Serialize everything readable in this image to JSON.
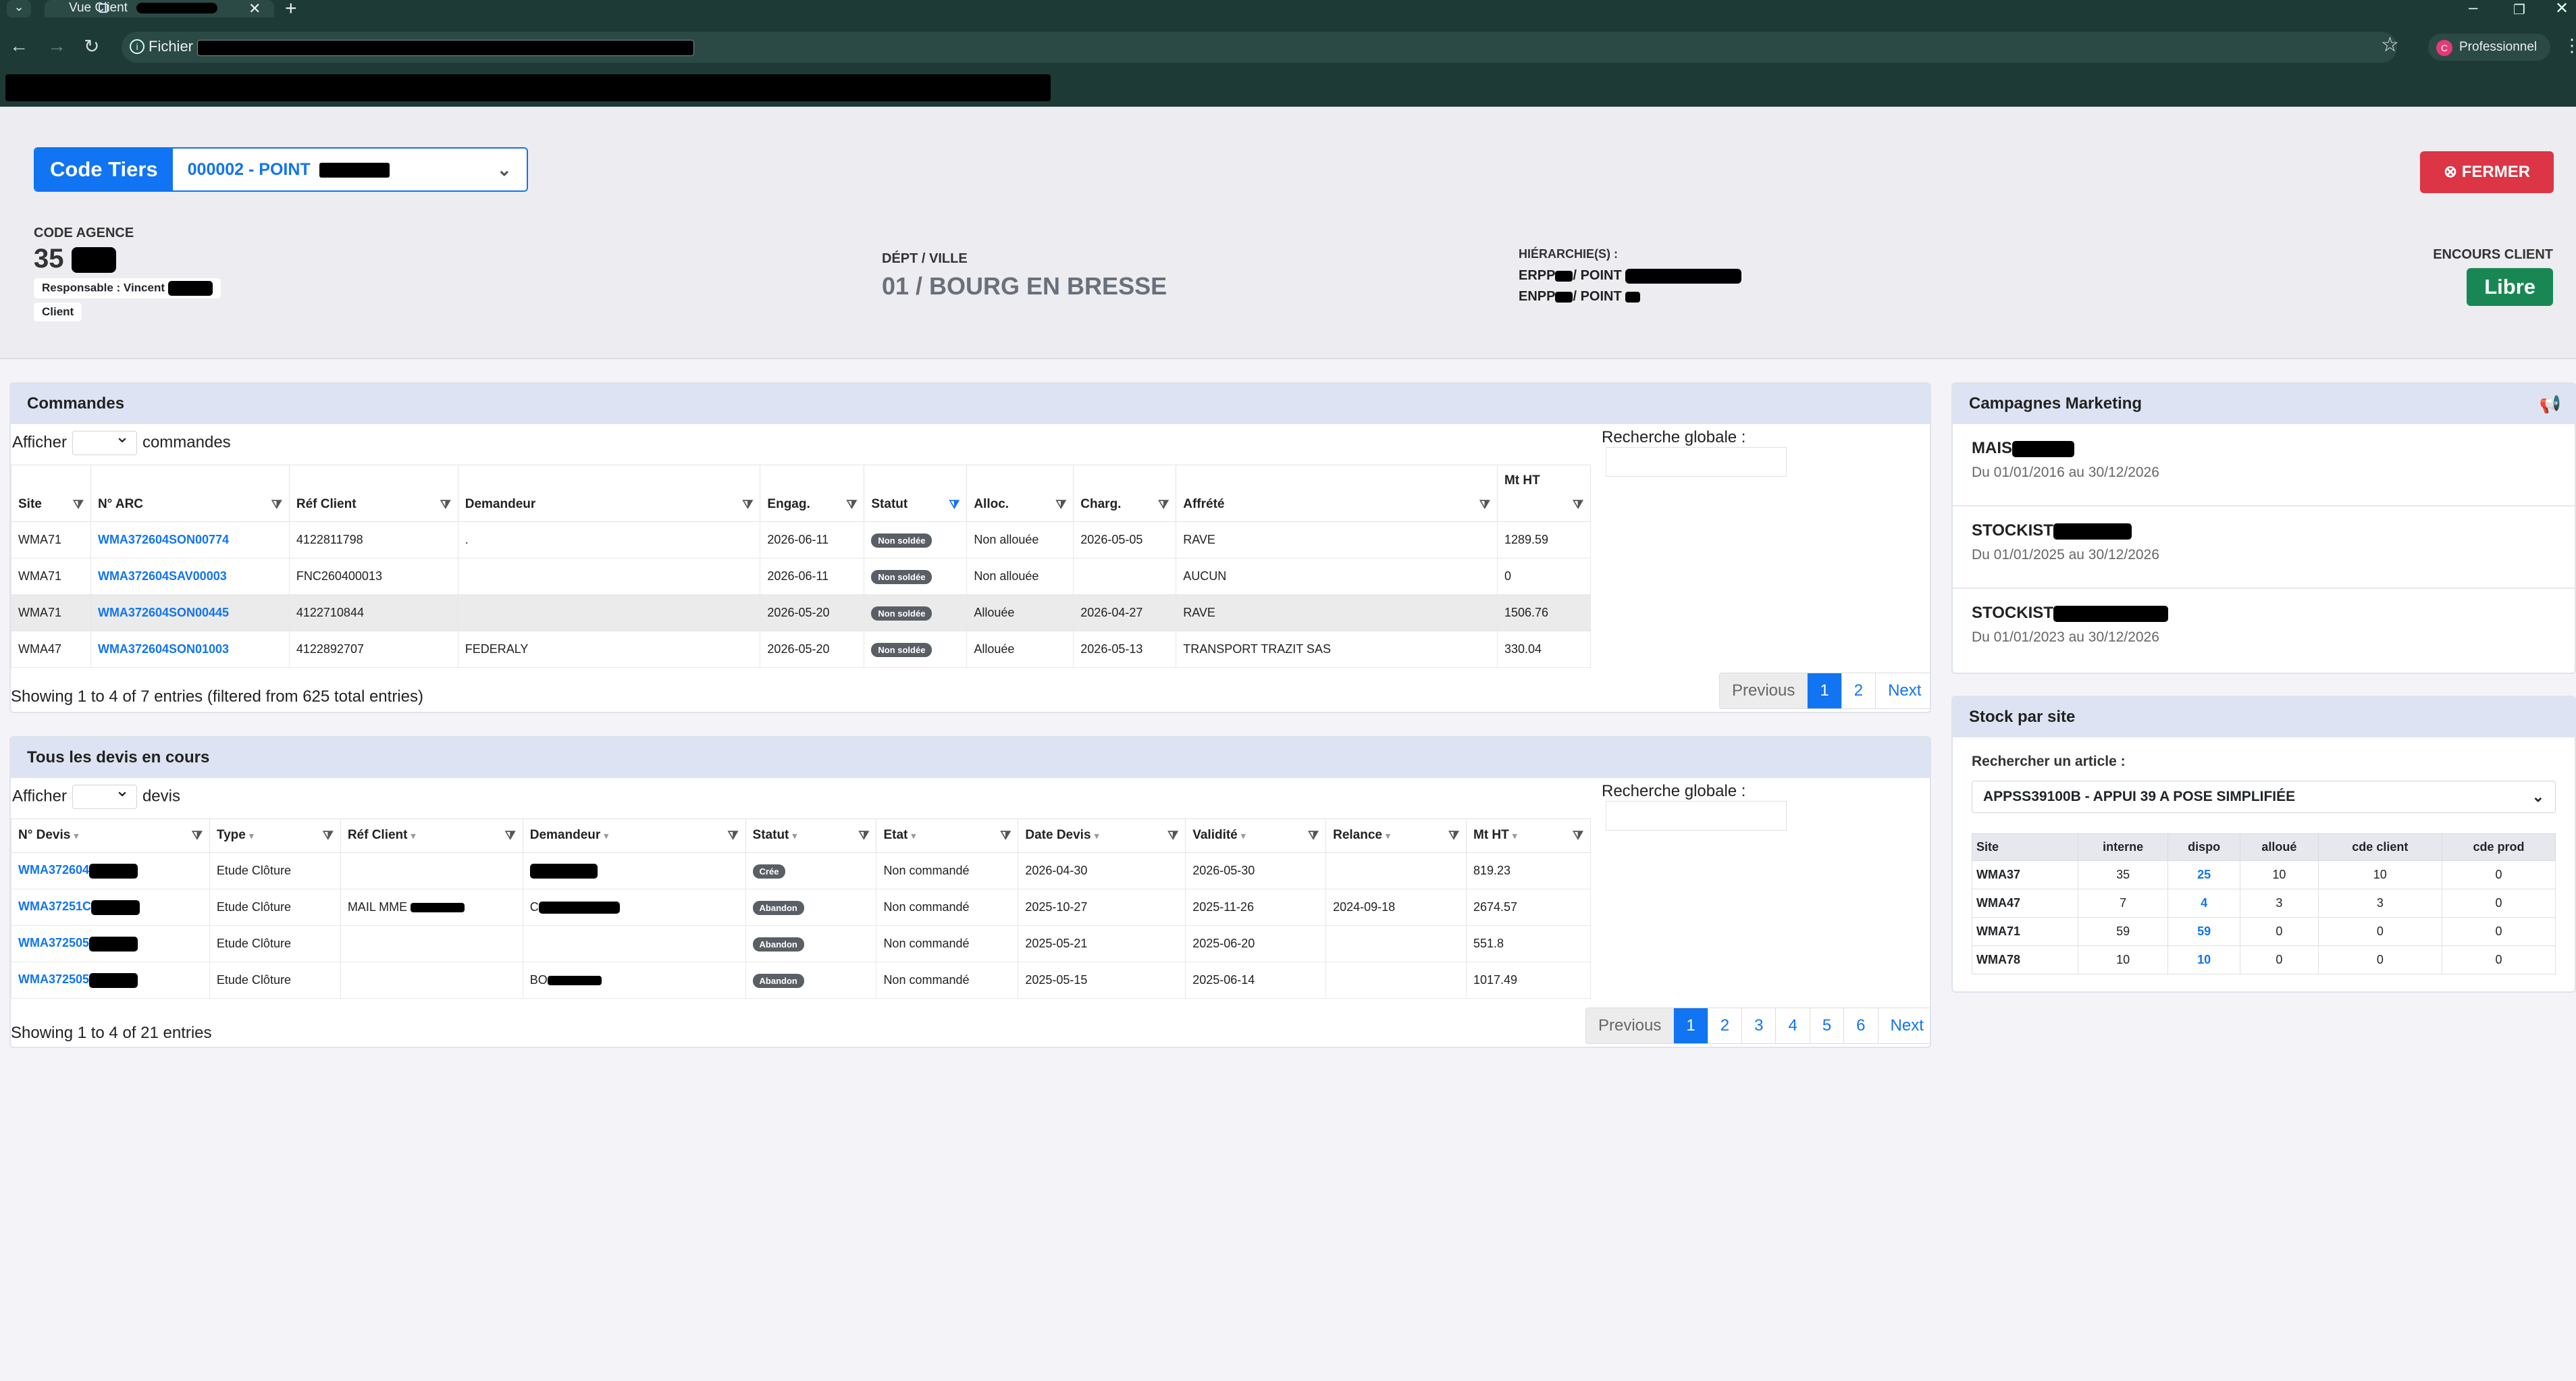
{
  "browser": {
    "tab_title": "Vue Client",
    "tab_close": "✕",
    "new_tab": "+",
    "url_scheme_label": "Fichier",
    "profile_initial": "C",
    "profile_label": "Professionnel"
  },
  "header": {
    "code_tiers_label": "Code Tiers",
    "code_tiers_value": "000002 - POINT",
    "fermer_label": "FERMER",
    "code_agence_label": "CODE AGENCE",
    "code_agence_value": "35",
    "responsable_label": "Responsable : Vincent",
    "client_tag": "Client",
    "dept_ville_label": "DÉPT / VILLE",
    "dept_ville_value": "01 / BOURG EN BRESSE",
    "hierarchie_label": "HIÉRARCHIE(S) :",
    "hierarchie_lines": [
      "ERPP",
      "/ POINT",
      "ENPP",
      "/ POINT"
    ],
    "encours_label": "ENCOURS CLIENT",
    "encours_value": "Libre"
  },
  "commandes": {
    "title": "Commandes",
    "afficher": "Afficher",
    "afficher_suffix": "commandes",
    "search_label": "Recherche globale :",
    "columns": [
      "Site",
      "N° ARC",
      "Réf Client",
      "Demandeur",
      "Engag.",
      "Statut",
      "Alloc.",
      "Charg.",
      "Affrété",
      "Mt HT"
    ],
    "rows": [
      [
        "WMA71",
        "WMA372604SON00774",
        "4122811798",
        ".",
        "2026-06-11",
        "Non soldée",
        "Non allouée",
        "2026-05-05",
        "RAVE",
        "1289.59"
      ],
      [
        "WMA71",
        "WMA372604SAV00003",
        "FNC260400013",
        "",
        "2026-06-11",
        "Non soldée",
        "Non allouée",
        "",
        "AUCUN",
        "0"
      ],
      [
        "WMA71",
        "WMA372604SON00445",
        "4122710844",
        "",
        "2026-05-20",
        "Non soldée",
        "Allouée",
        "2026-04-27",
        "RAVE",
        "1506.76"
      ],
      [
        "WMA47",
        "WMA372604SON01003",
        "4122892707",
        "FEDERALY",
        "2026-05-20",
        "Non soldée",
        "Allouée",
        "2026-05-13",
        "TRANSPORT TRAZIT SAS",
        "330.04"
      ]
    ],
    "info": "Showing 1 to 4 of 7 entries (filtered from 625 total entries)",
    "pages": [
      "Previous",
      "1",
      "2",
      "Next"
    ]
  },
  "devis": {
    "title": "Tous les devis en cours",
    "afficher": "Afficher",
    "afficher_suffix": "devis",
    "search_label": "Recherche globale :",
    "columns": [
      "N° Devis",
      "Type",
      "Réf Client",
      "Demandeur",
      "Statut",
      "Etat",
      "Date Devis",
      "Validité",
      "Relance",
      "Mt HT"
    ],
    "rows": [
      [
        "WMA372604",
        "Etude Clôture",
        "",
        "",
        "Crée",
        "Non commandé",
        "2026-04-30",
        "2026-05-30",
        "",
        "819.23"
      ],
      [
        "WMA37251C",
        "Etude Clôture",
        "MAIL MME",
        "C",
        "Abandon",
        "Non commandé",
        "2025-10-27",
        "2025-11-26",
        "2024-09-18",
        "2674.57"
      ],
      [
        "WMA372505",
        "Etude Clôture",
        "",
        "",
        "Abandon",
        "Non commandé",
        "2025-05-21",
        "2025-06-20",
        "",
        "551.8"
      ],
      [
        "WMA372505",
        "Etude Clôture",
        "",
        "BO",
        "Abandon",
        "Non commandé",
        "2025-05-15",
        "2025-06-14",
        "",
        "1017.49"
      ]
    ],
    "info": "Showing 1 to 4 of 21 entries",
    "pages": [
      "Previous",
      "1",
      "2",
      "3",
      "4",
      "5",
      "6",
      "Next"
    ]
  },
  "campagnes": {
    "title": "Campagnes Marketing",
    "items": [
      {
        "name": "MAIS",
        "dates": "Du 01/01/2016 au 30/12/2026"
      },
      {
        "name": "STOCKIST",
        "dates": "Du 01/01/2025 au 30/12/2026"
      },
      {
        "name": "STOCKIST",
        "dates": "Du 01/01/2023 au 30/12/2026"
      }
    ]
  },
  "stock": {
    "title": "Stock par site",
    "search_label": "Rechercher un article :",
    "article": "APPSS39100B - APPUI 39 A POSE SIMPLIFIÉE",
    "columns": [
      "Site",
      "interne",
      "dispo",
      "alloué",
      "cde client",
      "cde prod"
    ],
    "rows": [
      [
        "WMA37",
        "35",
        "25",
        "10",
        "10",
        "0"
      ],
      [
        "WMA47",
        "7",
        "4",
        "3",
        "3",
        "0"
      ],
      [
        "WMA71",
        "59",
        "59",
        "0",
        "0",
        "0"
      ],
      [
        "WMA78",
        "10",
        "10",
        "0",
        "0",
        "0"
      ]
    ]
  }
}
